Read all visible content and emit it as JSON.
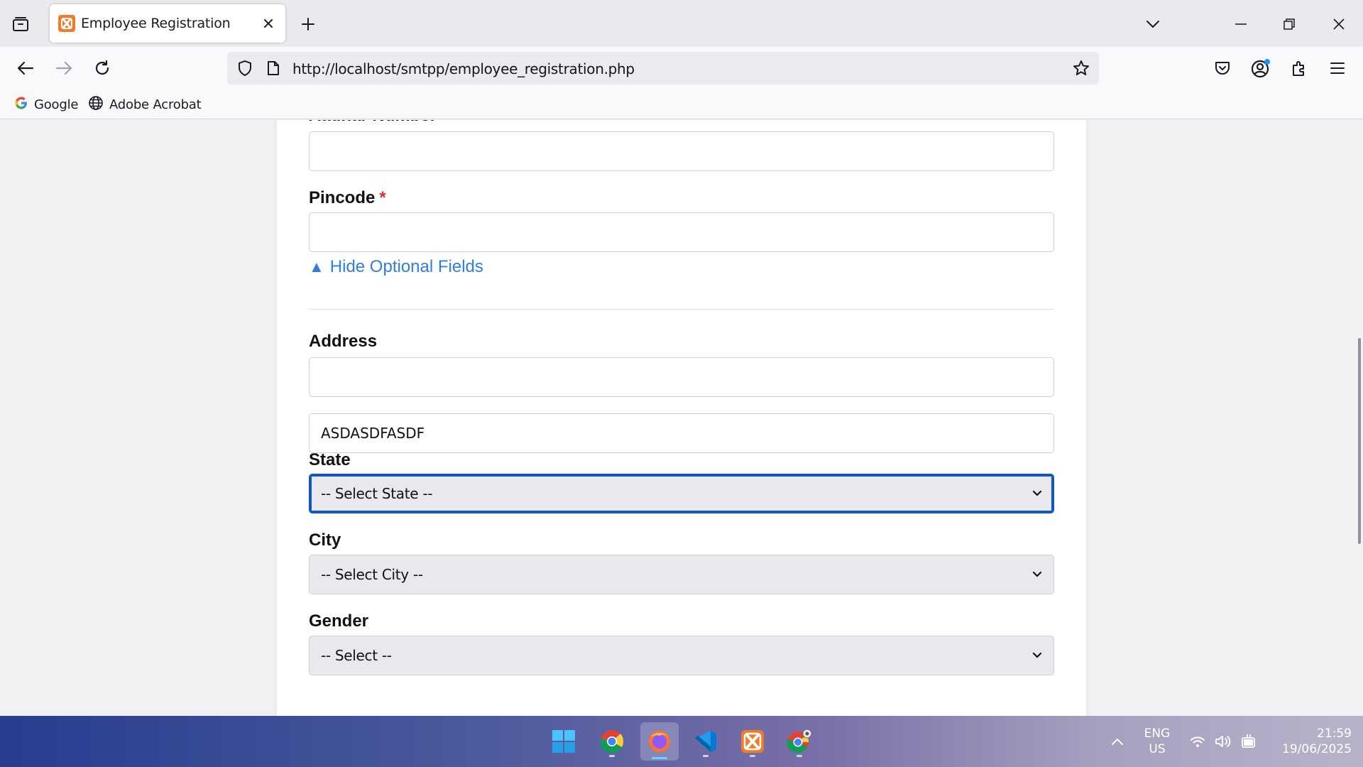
{
  "browser": {
    "tab_title": "Employee Registration",
    "url": "http://localhost/smtpp/employee_registration.php",
    "bookmarks": [
      {
        "label": "Google",
        "icon": "google-icon"
      },
      {
        "label": "Adobe Acrobat",
        "icon": "globe-icon"
      }
    ]
  },
  "form": {
    "aadhar_label": "Aadhar Number",
    "aadhar_value": "",
    "pincode_label": "Pincode",
    "pincode_required": "*",
    "pincode_value": "",
    "toggle_arrow": "▲",
    "toggle_label": "Hide Optional Fields",
    "address_label": "Address",
    "address_line1_value": "",
    "address_line2_value": "ASDASDFASDF",
    "state_label": "State",
    "state_selected": "-- Select State --",
    "city_label": "City",
    "city_selected": "-- Select City --",
    "gender_label": "Gender",
    "gender_selected": "-- Select --"
  },
  "taskbar": {
    "apps": [
      "windows-start-icon",
      "chrome-icon",
      "firefox-icon",
      "vscode-icon",
      "xampp-icon",
      "chrome-canary-icon"
    ],
    "language_top": "ENG",
    "language_bottom": "US",
    "time": "21:59",
    "date": "19/06/2025"
  },
  "colors": {
    "accent_link": "#2f7ee8",
    "focus_ring": "#0b57d0",
    "required": "#e03131",
    "xampp_orange": "#f27b28"
  }
}
